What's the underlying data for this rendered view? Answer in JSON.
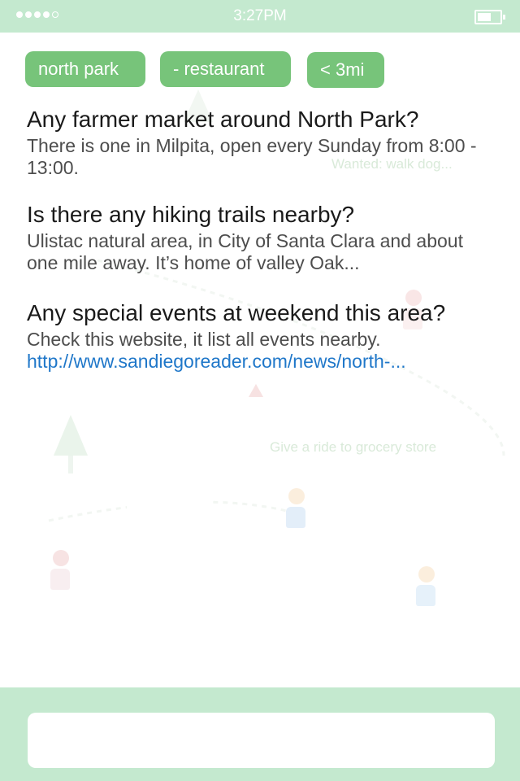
{
  "status_bar": {
    "time": "3:27PM",
    "signal_bars": 4,
    "battery_level": 0.6
  },
  "background_map": {
    "ghost_labels": [
      "Wanted: walk dog...",
      "Give a ride to grocery store"
    ]
  },
  "filters": [
    {
      "label": "north park"
    },
    {
      "label": "- restaurant"
    },
    {
      "label": "< 3mi"
    }
  ],
  "qa": [
    {
      "question": "Any farmer market around North Park?",
      "answer": "There is one in Milpita, open every Sunday from 8:00 - 13:00."
    },
    {
      "question": "Is there any hiking trails nearby?",
      "answer": "Ulistac natural area, in City of Santa Clara and about one mile away. It’s home of valley Oak..."
    },
    {
      "question": "Any special events at weekend this area?",
      "answer": "Check this website, it list all events nearby.",
      "link": "http://www.sandiegoreader.com/news/north-..."
    }
  ],
  "input": {
    "value": "",
    "placeholder": ""
  },
  "colors": {
    "bar_green": "#c4e9cf",
    "chip_green": "#77c47a",
    "link_blue": "#1f77c9"
  }
}
